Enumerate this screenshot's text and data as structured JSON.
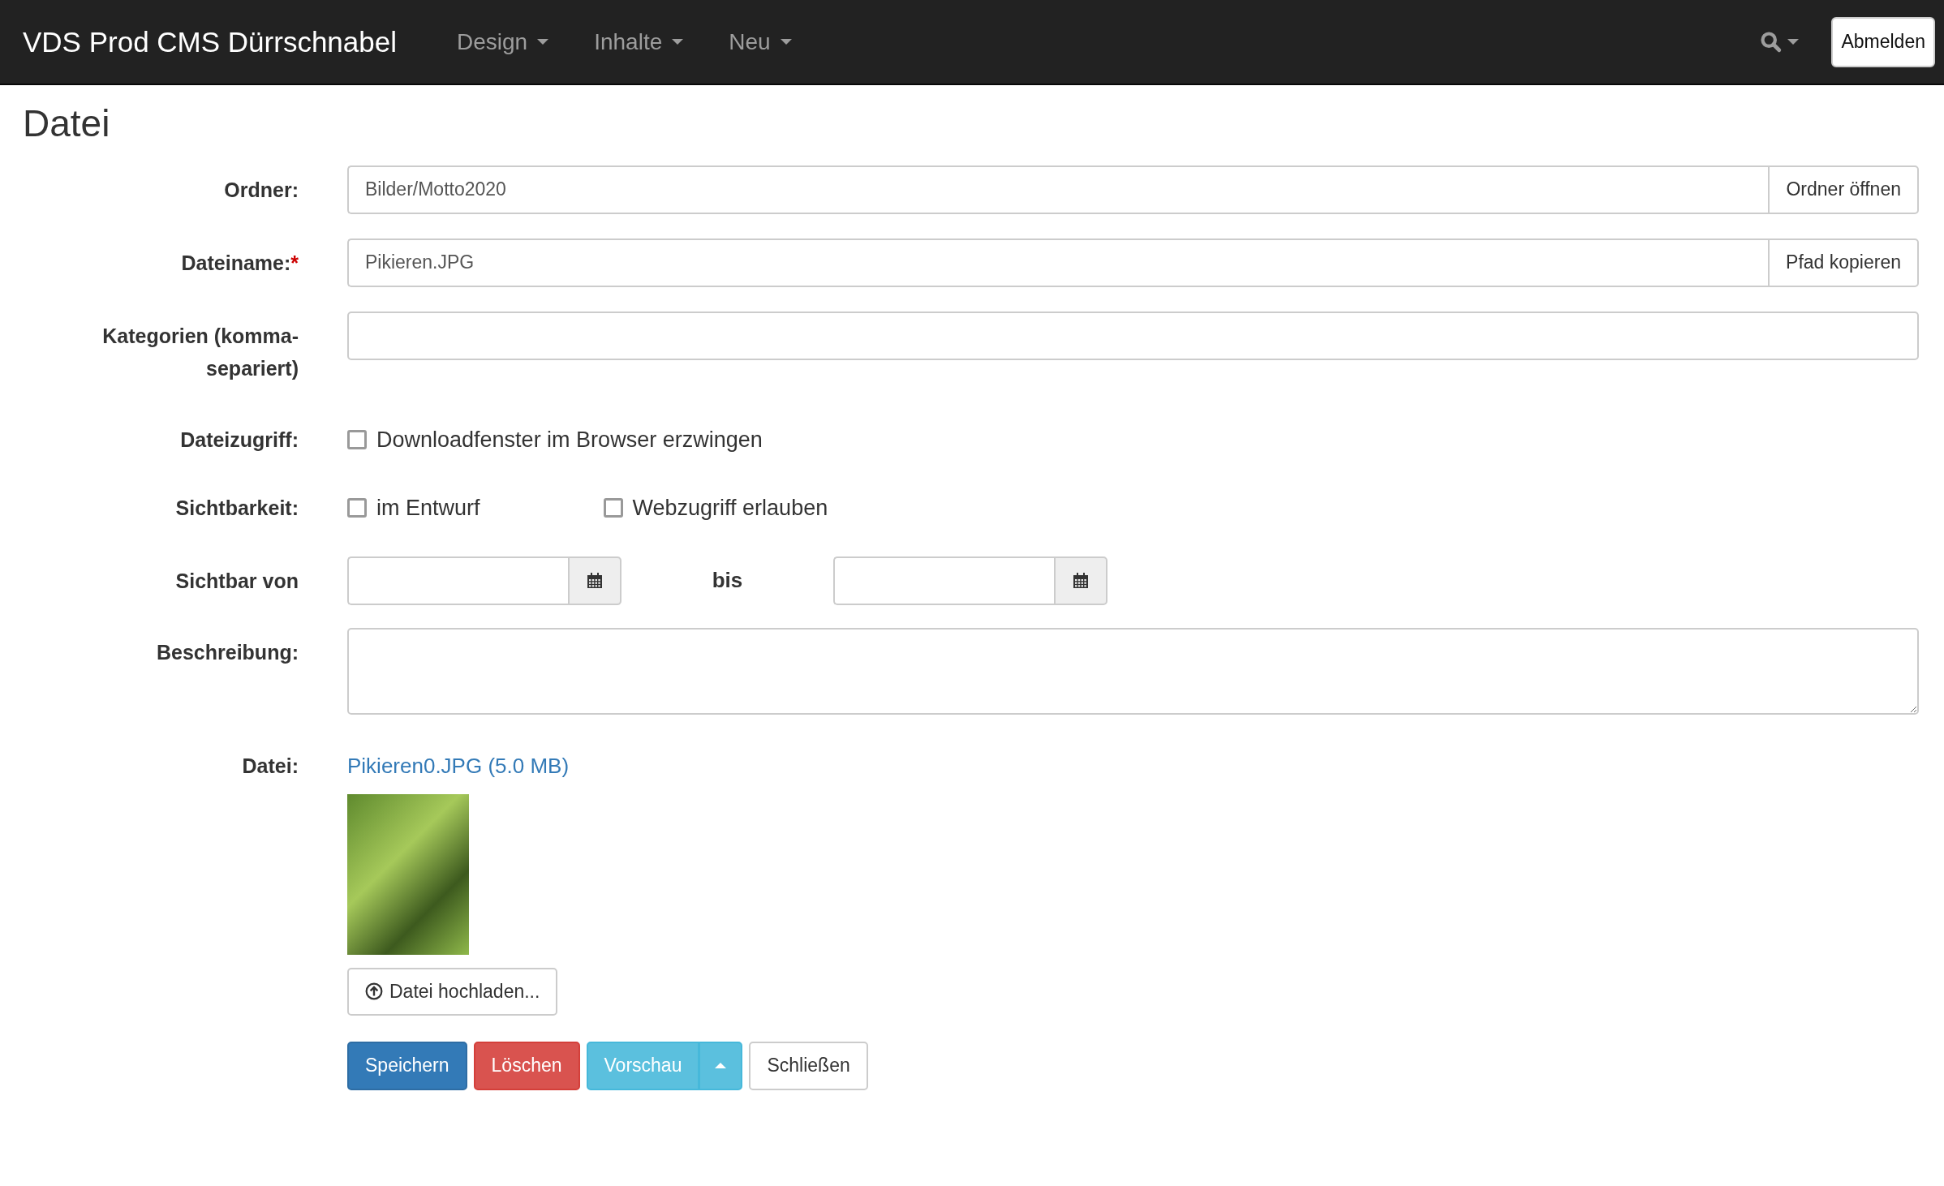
{
  "navbar": {
    "brand": "VDS Prod CMS Dürrschnabel",
    "menus": [
      {
        "label": "Design"
      },
      {
        "label": "Inhalte"
      },
      {
        "label": "Neu"
      }
    ],
    "logout_button": "Abmelden"
  },
  "page_title": "Datei",
  "fields": [
    {
      "kind": "input_addon",
      "label": "Ordner:",
      "value": "Bilder/Motto2020",
      "button": "Ordner öffnen"
    },
    {
      "kind": "input_addon",
      "label": "Dateiname:",
      "required_mark": "*",
      "value": "Pikieren.JPG",
      "button": "Pfad kopieren"
    },
    {
      "kind": "input",
      "label": "Kategorien (komma-separiert)"
    },
    {
      "kind": "checkboxes",
      "label": "Dateizugriff:",
      "options": [
        {
          "label": "Downloadfenster im Browser erzwingen",
          "checked": false
        }
      ]
    },
    {
      "kind": "checkboxes",
      "label": "Sichtbarkeit:",
      "options": [
        {
          "label": "im Entwurf",
          "checked": false
        },
        {
          "label": "Webzugriff erlauben",
          "checked": false
        }
      ]
    },
    {
      "kind": "daterange",
      "label": "Sichtbar von",
      "separator": "bis"
    },
    {
      "kind": "textarea",
      "label": "Beschreibung:"
    },
    {
      "kind": "file",
      "label": "Datei:",
      "link": "Pikieren0.JPG (5.0 MB)",
      "upload_button": "Datei hochladen..."
    }
  ],
  "actions": [
    {
      "kind": "primary",
      "label": "Speichern"
    },
    {
      "kind": "danger",
      "label": "Löschen"
    },
    {
      "kind": "info_split",
      "label": "Vorschau"
    },
    {
      "kind": "default",
      "label": "Schließen"
    }
  ]
}
